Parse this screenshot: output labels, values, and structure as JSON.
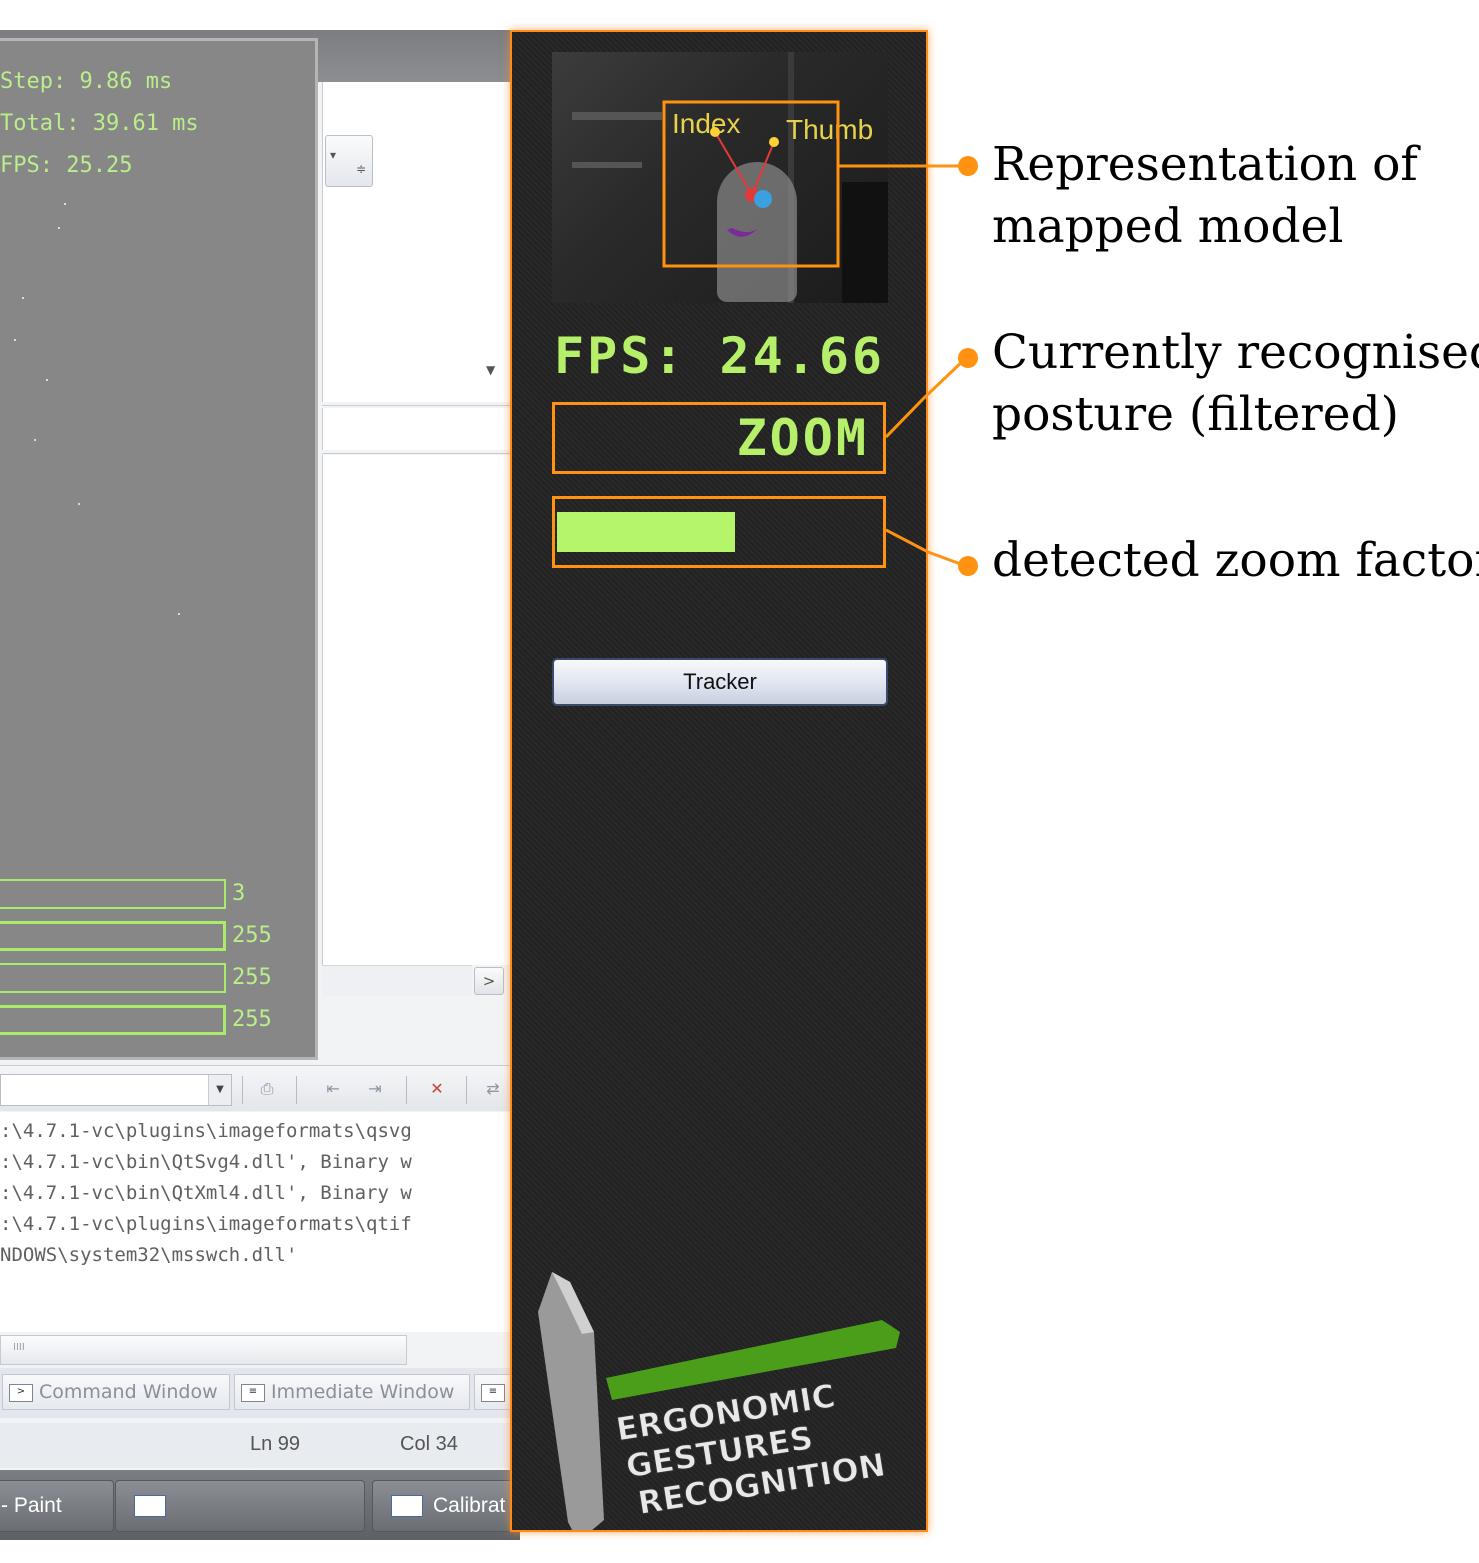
{
  "debug_overlay": {
    "lines": [
      "Step: 9.86 ms",
      "Total: 39.61 ms",
      "FPS: 25.25"
    ],
    "bar_values": [
      "3",
      "255",
      "255",
      "255"
    ],
    "text_color": "#b9ee8a"
  },
  "output_window": {
    "lines": [
      ":\\4.7.1-vc\\plugins\\imageformats\\qsvg",
      ":\\4.7.1-vc\\bin\\QtSvg4.dll', Binary w",
      ":\\4.7.1-vc\\bin\\QtXml4.dll', Binary w",
      ":\\4.7.1-vc\\plugins\\imageformats\\qtif",
      "NDOWS\\system32\\msswch.dll'"
    ]
  },
  "ide_tabs": [
    "Command Window",
    "Immediate Window"
  ],
  "statusbar": {
    "ln": "Ln 99",
    "col": "Col 34"
  },
  "taskbar": {
    "items": [
      "- Paint",
      "",
      "Calibrat"
    ]
  },
  "panel": {
    "overlay_labels": [
      "Index",
      "Thumb"
    ],
    "fps": "FPS: 24.66",
    "posture": "ZOOM",
    "zoom_fraction": 0.55,
    "tracker_button": "Tracker",
    "logo_lines": [
      "ERGONOMIC",
      "GESTURES",
      "RECOGNITION"
    ]
  },
  "annotations": [
    {
      "lines": [
        "Representation of",
        "mapped model"
      ]
    },
    {
      "lines": [
        "Currently recognised",
        "posture (filtered)"
      ]
    },
    {
      "lines": [
        "detected zoom factor"
      ]
    }
  ],
  "colors": {
    "accent_orange": "#ff9211",
    "fps_green": "#b6f06a",
    "logo_green": "#4a9e1a"
  }
}
